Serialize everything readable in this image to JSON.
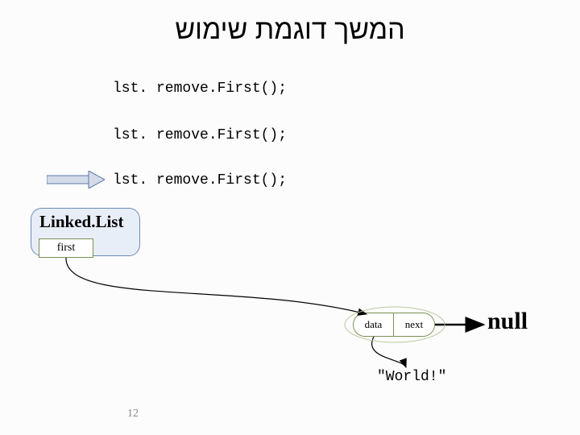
{
  "title": "המשך דוגמת שימוש",
  "code_lines": [
    "lst. remove.First();",
    "lst. remove.First();",
    "lst. remove.First();"
  ],
  "linked_list_label": "Linked.List",
  "first_label": "first",
  "node": {
    "data_label": "data",
    "next_label": "next"
  },
  "null_label": "null",
  "data_value": "\"World!\"",
  "page_number": "12"
}
